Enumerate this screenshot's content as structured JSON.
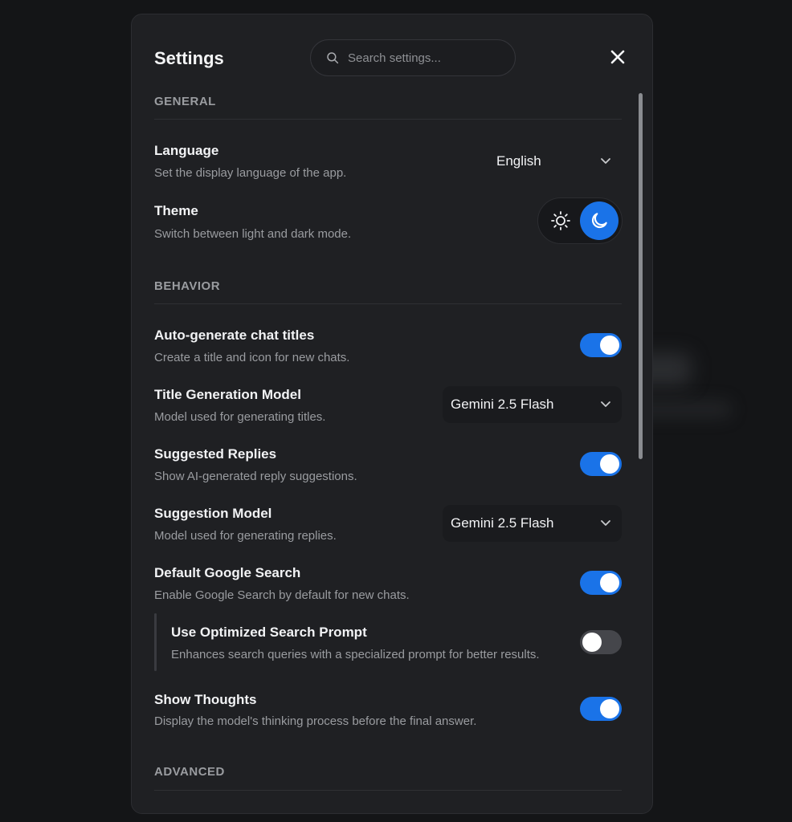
{
  "header": {
    "title": "Settings",
    "search_placeholder": "Search settings...",
    "icons": {
      "search": "search-icon",
      "close": "close-icon"
    }
  },
  "sections": {
    "general": "GENERAL",
    "behavior": "BEHAVIOR",
    "advanced": "ADVANCED"
  },
  "language": {
    "title": "Language",
    "desc": "Set the display language of the app.",
    "value": "English"
  },
  "theme": {
    "title": "Theme",
    "desc": "Switch between light and dark mode.",
    "selected": "dark",
    "icons": {
      "light": "sun-icon",
      "dark": "moon-icon"
    }
  },
  "auto_titles": {
    "title": "Auto-generate chat titles",
    "desc": "Create a title and icon for new chats.",
    "enabled": true
  },
  "title_model": {
    "title": "Title Generation Model",
    "desc": "Model used for generating titles.",
    "value": "Gemini 2.5 Flash"
  },
  "suggested_replies": {
    "title": "Suggested Replies",
    "desc": "Show AI-generated reply suggestions.",
    "enabled": true
  },
  "suggestion_model": {
    "title": "Suggestion Model",
    "desc": "Model used for generating replies.",
    "value": "Gemini 2.5 Flash"
  },
  "google_search": {
    "title": "Default Google Search",
    "desc": "Enable Google Search by default for new chats.",
    "enabled": true
  },
  "optimized_search": {
    "title": "Use Optimized Search Prompt",
    "desc": "Enhances search queries with a specialized prompt for better results.",
    "enabled": false
  },
  "show_thoughts": {
    "title": "Show Thoughts",
    "desc": "Display the model's thinking process before the final answer.",
    "enabled": true
  },
  "colors": {
    "accent": "#1a73e8",
    "background": "#141517",
    "panel": "#1f2023",
    "toggle_off": "#45464b"
  }
}
